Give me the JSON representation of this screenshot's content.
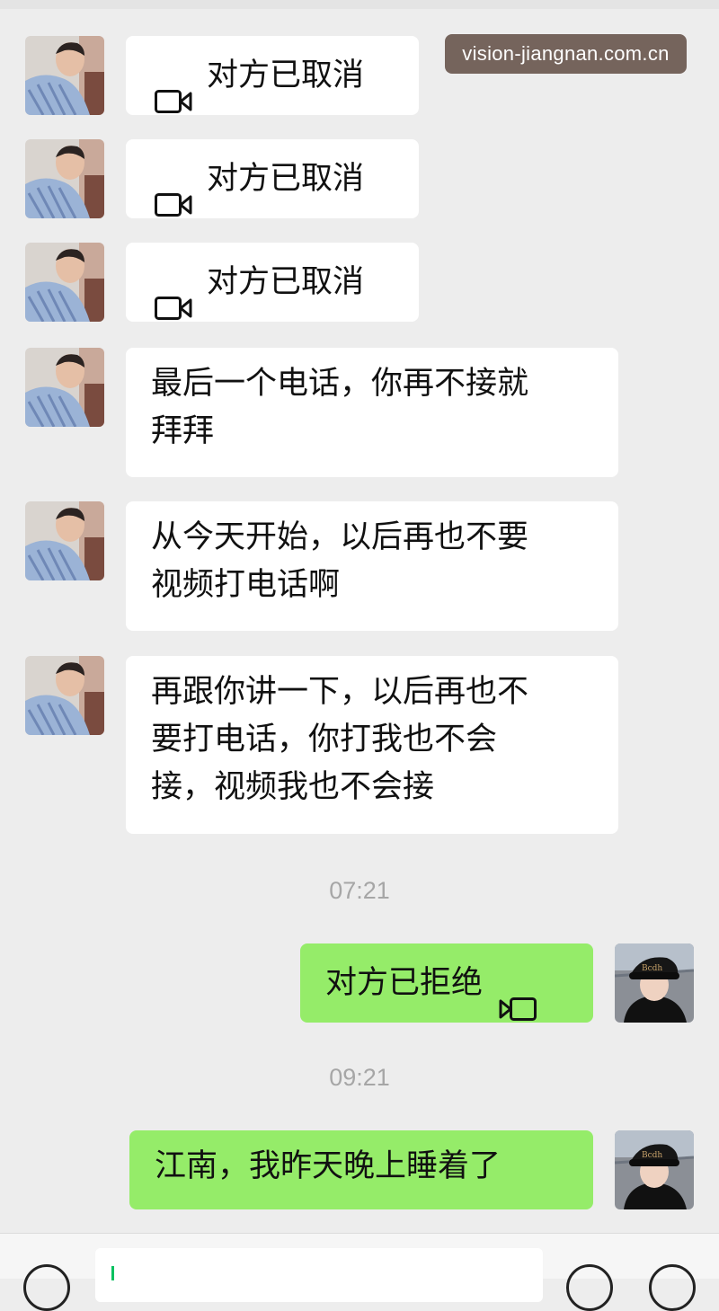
{
  "watermark": "vision-jiangnan.com.cn",
  "messages": [
    {
      "side": "left",
      "type": "call",
      "text": "对方已取消",
      "icon": "video-call-icon"
    },
    {
      "side": "left",
      "type": "call",
      "text": "对方已取消",
      "icon": "video-call-icon"
    },
    {
      "side": "left",
      "type": "call",
      "text": "对方已取消",
      "icon": "video-call-icon"
    },
    {
      "side": "left",
      "type": "text",
      "text": "最后一个电话，你再不接就\n拜拜"
    },
    {
      "side": "left",
      "type": "text",
      "text": "从今天开始，以后再也不要\n视频打电话啊"
    },
    {
      "side": "left",
      "type": "text",
      "text": "再跟你讲一下，以后再也不\n要打电话，你打我也不会\n接，视频我也不会接"
    },
    {
      "side": "right",
      "type": "call",
      "text": "对方已拒绝",
      "icon": "video-call-icon"
    },
    {
      "side": "right",
      "type": "text",
      "text": "江南，我昨天晚上睡着了"
    }
  ],
  "timestamps": [
    "07:21",
    "09:21"
  ],
  "input_bar": {
    "icons": [
      "voice-icon",
      "emoji-icon",
      "plus-icon"
    ]
  },
  "colors": {
    "background": "#ededed",
    "bubble_incoming": "#ffffff",
    "bubble_outgoing": "#95ec69",
    "timestamp": "#a6a6a6",
    "watermark_bg": "#5a463c"
  }
}
